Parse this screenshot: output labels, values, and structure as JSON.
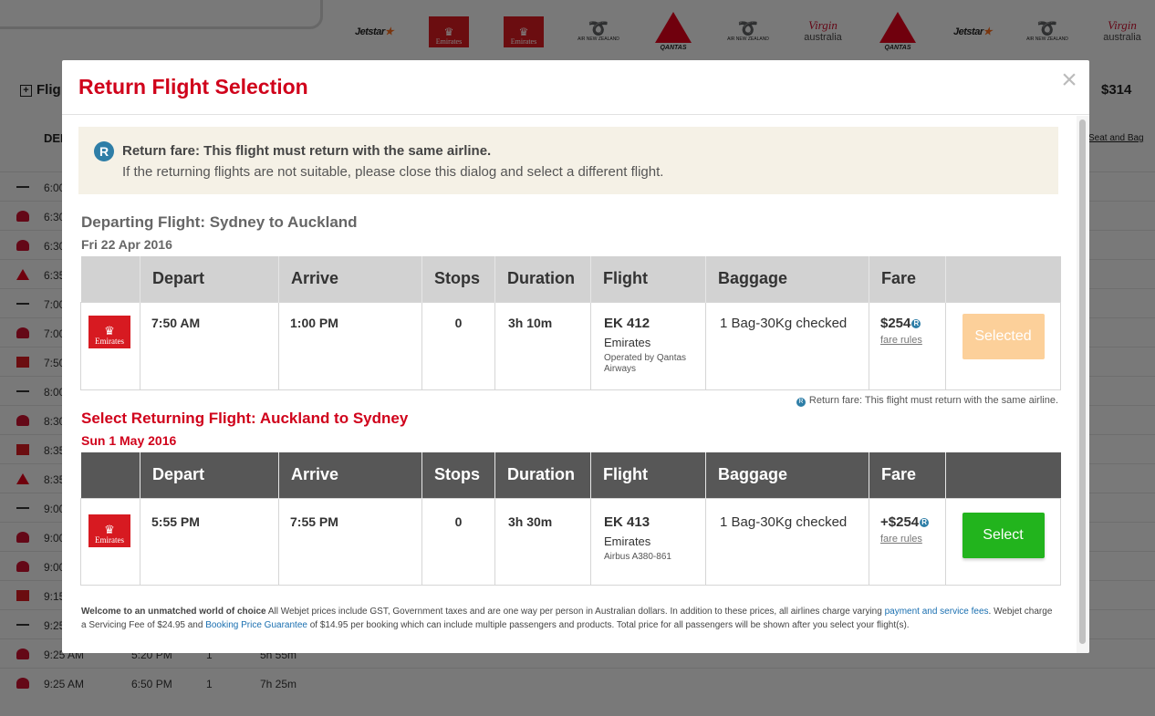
{
  "background": {
    "logos": [
      {
        "name": "jetstar",
        "text": "Jetstar"
      },
      {
        "name": "emirates",
        "text": "Emirates"
      },
      {
        "name": "emirates",
        "text": "Emirates"
      },
      {
        "name": "airnz",
        "text": "AIR NEW ZEALAND"
      },
      {
        "name": "qantas",
        "text": "QANTAS"
      },
      {
        "name": "airnz",
        "text": "AIR NEW ZEALAND"
      },
      {
        "name": "virgin",
        "text": "australia"
      },
      {
        "name": "qantas",
        "text": "QANTAS"
      },
      {
        "name": "jetstar",
        "text": "Jetstar"
      },
      {
        "name": "airnz",
        "text": "AIR NEW ZEALAND"
      },
      {
        "name": "virgin",
        "text": "australia"
      }
    ],
    "flights_heading": "Flig",
    "price": "$314",
    "dep_header": "DEP",
    "seat_and_bag": "Seat and Bag",
    "rows": [
      {
        "airline": "airnz",
        "time": "6:00"
      },
      {
        "airline": "virgin",
        "time": "6:30"
      },
      {
        "airline": "virgin",
        "time": "6:30"
      },
      {
        "airline": "qantas",
        "time": "6:35"
      },
      {
        "airline": "airnz",
        "time": "7:00"
      },
      {
        "airline": "virgin",
        "time": "7:00"
      },
      {
        "airline": "emirates",
        "time": "7:50"
      },
      {
        "airline": "airnz",
        "time": "8:00"
      },
      {
        "airline": "virgin",
        "time": "8:30"
      },
      {
        "airline": "emirates",
        "time": "8:35"
      },
      {
        "airline": "qantas",
        "time": "8:35"
      },
      {
        "airline": "airnz",
        "time": "9:00"
      },
      {
        "airline": "virgin",
        "time": "9:00"
      },
      {
        "airline": "virgin",
        "time": "9:00"
      },
      {
        "airline": "emirates",
        "time": "9:15"
      },
      {
        "airline": "airnz",
        "time": "9:25"
      },
      {
        "airline": "virgin",
        "time": "9:25 AM",
        "arrive": "5:20 PM",
        "stops": "1",
        "duration": "5h 55m"
      },
      {
        "airline": "virgin",
        "time": "9:25 AM",
        "arrive": "6:50 PM",
        "stops": "1",
        "duration": "7h 25m"
      }
    ]
  },
  "modal": {
    "title": "Return Flight Selection",
    "close_symbol": "×",
    "notice": {
      "badge": "R",
      "line1": "Return fare: This flight must return with the same airline.",
      "line2": "If the returning flights are not suitable, please close this dialog and select a different flight."
    },
    "departing": {
      "title": "Departing Flight: Sydney to Auckland",
      "date": "Fri 22 Apr 2016",
      "columns": [
        "",
        "Depart",
        "Arrive",
        "Stops",
        "Duration",
        "Flight",
        "Baggage",
        "Fare",
        ""
      ],
      "flight": {
        "airline_logo": "Emirates",
        "depart": "7:50 AM",
        "arrive": "1:00 PM",
        "stops": "0",
        "duration": "3h 10m",
        "flight_code": "EK 412",
        "airline": "Emirates",
        "note": "Operated by Qantas Airways",
        "baggage": "1 Bag-30Kg checked",
        "fare": "$254",
        "fare_badge": "R",
        "fare_rules": "fare rules",
        "button": "Selected"
      },
      "footnote_badge": "R",
      "footnote": "Return fare: This flight must return with the same airline."
    },
    "returning": {
      "title": "Select Returning Flight: Auckland to Sydney",
      "date": "Sun 1 May 2016",
      "columns": [
        "",
        "Depart",
        "Arrive",
        "Stops",
        "Duration",
        "Flight",
        "Baggage",
        "Fare",
        ""
      ],
      "flight": {
        "airline_logo": "Emirates",
        "depart": "5:55 PM",
        "arrive": "7:55 PM",
        "stops": "0",
        "duration": "3h 30m",
        "flight_code": "EK 413",
        "airline": "Emirates",
        "note": "Airbus A380-861",
        "baggage": "1 Bag-30Kg checked",
        "fare": "+$254",
        "fare_badge": "R",
        "fare_rules": "fare rules",
        "button": "Select"
      }
    },
    "footer": {
      "bold": "Welcome to an unmatched world of choice",
      "text1": " All Webjet prices include GST, Government taxes and are one way per person in Australian dollars. In addition to these prices, all airlines charge varying ",
      "link1": "payment and service fees",
      "text2": ". Webjet charge a Servicing Fee of $24.95 and ",
      "link2": "Booking Price Guarantee",
      "text3": " of $14.95 per booking which can include multiple passengers and products. Total price for all passengers will be shown after you select your flight(s)."
    }
  },
  "colors": {
    "brand_red": "#d0021b",
    "emirates_red": "#d71a21",
    "select_green": "#22b41d",
    "selected_orange": "#fcd09a",
    "info_blue": "#2e7ea7"
  }
}
